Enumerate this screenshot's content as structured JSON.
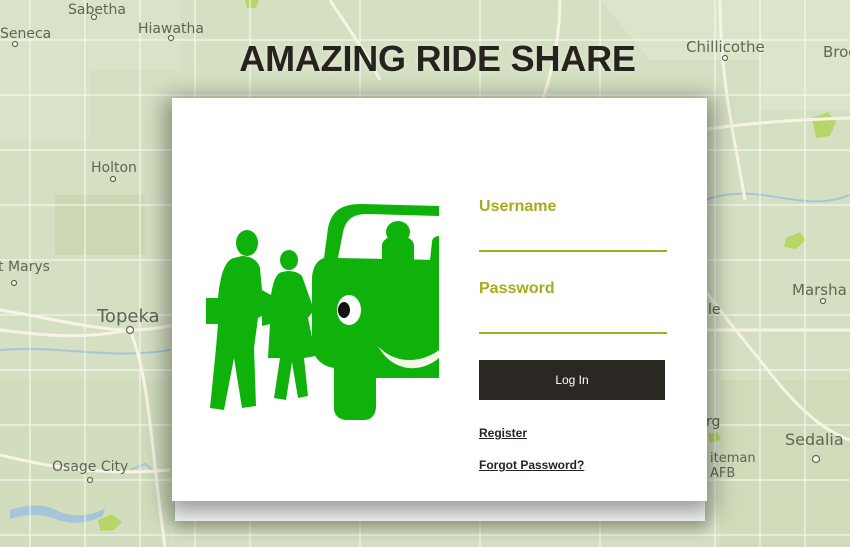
{
  "map": {
    "towns": [
      "Sabetha",
      "Hiawatha",
      "Seneca",
      "Holton",
      "t Marys",
      "Topeka",
      "Osage City",
      "Chillicothe",
      "Broo",
      "Marsha",
      "Sedalia",
      "le",
      "rg",
      "iteman",
      "AFB"
    ]
  },
  "header": {
    "title": "AMAZING RIDE SHARE"
  },
  "login": {
    "username_label": "Username",
    "username_value": "",
    "password_label": "Password",
    "password_value": "",
    "login_button": "Log In",
    "register_link": "Register",
    "forgot_link": "Forgot Password?"
  },
  "colors": {
    "accent": "#a5ad1a",
    "illustration_green": "#0eb20b",
    "button": "#2b2722"
  },
  "icons": {
    "illustration": "rideshare-family-car-icon"
  }
}
